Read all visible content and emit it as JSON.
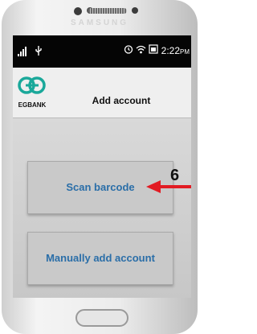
{
  "device": {
    "brand": "SAMSUNG"
  },
  "status_bar": {
    "left_icons": [
      "signal-icon",
      "usb-icon"
    ],
    "right_icons": [
      "alarm-icon",
      "wifi-icon",
      "battery-icon"
    ],
    "time": "2:22",
    "meridiem": "PM"
  },
  "app_bar": {
    "logo_text": "EGBANK",
    "title": "Add account"
  },
  "main": {
    "scan_button_label": "Scan barcode",
    "manual_button_label": "Manually add account"
  },
  "annotation": {
    "step_number": "6",
    "arrow_color": "#e21b23"
  },
  "colors": {
    "button_text": "#2a6ea8",
    "logo_teal": "#1aa89a"
  }
}
